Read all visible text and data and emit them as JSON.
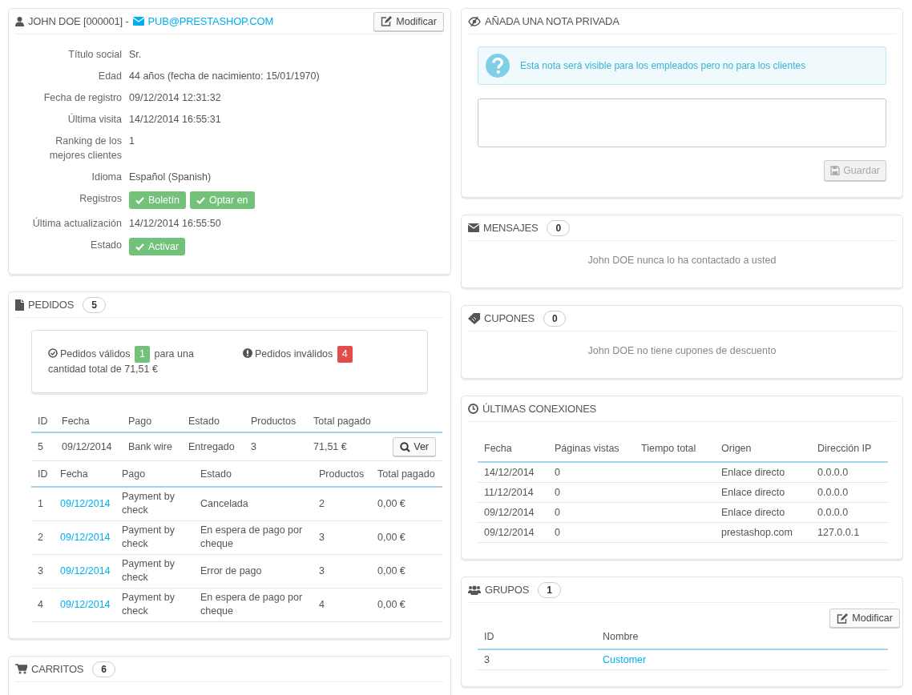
{
  "customer": {
    "title": "JOHN DOE [000001] -",
    "email": "PUB@PRESTASHOP.COM",
    "edit_button": "Modificar",
    "fields": [
      {
        "label": "Título social",
        "value": "Sr."
      },
      {
        "label": "Edad",
        "value": "44 años (fecha de nacimiento: 15/01/1970)"
      },
      {
        "label": "Fecha de registro",
        "value": "09/12/2014 12:31:32"
      },
      {
        "label": "Última visita",
        "value": "14/12/2014 16:55:31"
      },
      {
        "label": "Ranking de los mejores clientes",
        "value": "1"
      },
      {
        "label": "Idioma",
        "value": "Español (Spanish)"
      },
      {
        "label": "Registros",
        "badges": [
          {
            "label": "Boletín",
            "checked": true
          },
          {
            "label": "Optar en",
            "checked": true
          }
        ]
      },
      {
        "label": "Última actualización",
        "value": "14/12/2014 16:55:50"
      },
      {
        "label": "Estado",
        "badges": [
          {
            "label": "Activar",
            "checked": true
          }
        ]
      }
    ]
  },
  "orders": {
    "title": "PEDIDOS",
    "count": "5",
    "summary": {
      "valid_label": "Pedidos válidos",
      "valid_count": "1",
      "valid_suffix": "para una",
      "valid_total": "cantidad total de 71,51 €",
      "invalid_label": "Pedidos inválidos",
      "invalid_count": "4"
    },
    "valid_table": {
      "columns": [
        "ID",
        "Fecha",
        "Pago",
        "Estado",
        "Productos",
        "Total pagado"
      ],
      "rows": [
        {
          "cells": [
            "5",
            "09/12/2014",
            "Bank wire",
            "Entregado",
            "3",
            "71,51 €"
          ],
          "button": "Ver"
        }
      ]
    },
    "invalid_table": {
      "columns": [
        "ID",
        "Fecha",
        "Pago",
        "Estado",
        "Productos",
        "Total pagado"
      ],
      "rows": [
        {
          "cells": [
            "1",
            "09/12/2014",
            "Payment by check",
            "Cancelada",
            "2",
            "0,00 €"
          ]
        },
        {
          "cells": [
            "2",
            "09/12/2014",
            "Payment by check",
            "En espera de pago por cheque",
            "3",
            "0,00 €"
          ]
        },
        {
          "cells": [
            "3",
            "09/12/2014",
            "Payment by check",
            "Error de pago",
            "3",
            "0,00 €"
          ]
        },
        {
          "cells": [
            "4",
            "09/12/2014",
            "Payment by check",
            "En espera de pago por cheque",
            "4",
            "0,00 €"
          ]
        }
      ]
    }
  },
  "carts": {
    "title": "CARRITOS",
    "count": "6"
  },
  "private_note": {
    "title": "AÑADA UNA NOTA PRIVADA",
    "info": "Esta nota será visible para los empleados pero no para los clientes",
    "save_button": "Guardar",
    "save_disabled": true
  },
  "messages": {
    "title": "MENSAJES",
    "count": "0",
    "empty_text": "John DOE nunca lo ha contactado a usted"
  },
  "vouchers": {
    "title": "CUPONES",
    "count": "0",
    "empty_text": "John DOE no tiene cupones de descuento"
  },
  "connections": {
    "title": "ÚLTIMAS CONEXIONES",
    "columns": [
      "Fecha",
      "Páginas vistas",
      "Tiempo total",
      "Origen",
      "Dirección IP"
    ],
    "rows": [
      {
        "date": "14/12/2014",
        "page_views": "0",
        "origin": "Enlace directo",
        "ip_address": "0.0.0.0"
      },
      {
        "date": "11/12/2014",
        "page_views": "0",
        "origin": "Enlace directo",
        "ip_address": "0.0.0.0"
      },
      {
        "date": "09/12/2014",
        "page_views": "0",
        "origin": "Enlace directo",
        "ip_address": "0.0.0.0"
      },
      {
        "date": "09/12/2014",
        "page_views": "0",
        "origin": "prestashop.com",
        "ip_address": "127.0.0.1"
      }
    ]
  },
  "groups": {
    "title": "GRUPOS",
    "count": "1",
    "edit_button": "Modificar",
    "columns": [
      "ID",
      "Nombre"
    ],
    "rows": [
      {
        "id": "3",
        "name": "Customer"
      }
    ]
  }
}
